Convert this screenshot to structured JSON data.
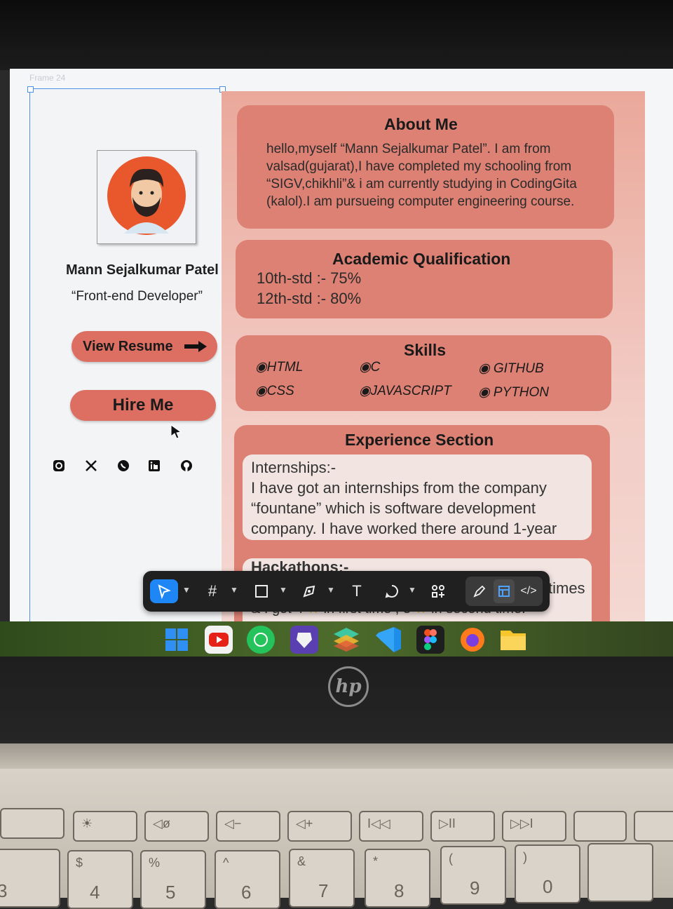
{
  "canvas": {
    "frame_label": "Frame 24"
  },
  "profile": {
    "name": "Mann Sejalkumar Patel",
    "role": "“Front-end Developer”",
    "view_resume_label": "View Resume",
    "hire_me_label": "Hire Me",
    "social_icons": [
      "instagram-icon",
      "x-icon",
      "whatsapp-icon",
      "linkedin-icon",
      "github-icon"
    ]
  },
  "about": {
    "title": "About Me",
    "lines": [
      "hello,myself “Mann Sejalkumar Patel”.  I am from",
      "valsad(gujarat),I have completed my schooling from",
      "“SIGV,chikhli”& i am currently studying in CodingGita",
      "(kalol).I am pursueing computer engineering course."
    ]
  },
  "academic": {
    "title": "Academic Qualification",
    "rows": [
      "10th-std :- 75%",
      "12th-std :- 80%"
    ]
  },
  "skills": {
    "title": "Skills",
    "items": [
      "HTML",
      "C",
      "GITHUB",
      "CSS",
      "JAVASCRIPT",
      "PYTHON"
    ]
  },
  "experience": {
    "title": "Experience Section",
    "internship_heading": "Internships:-",
    "internship_lines": [
      "I have got an internships from the company",
      "“fountane” which is software development",
      "company. I have worked there around 1-year"
    ],
    "hackathon_heading": "Hackathons:-",
    "hackathon_partial_1": "times",
    "hackathon_partial_2": "& I got 4",
    "hackathon_partial_3": "in first time , 3",
    "hackathon_partial_4": "in second time."
  },
  "toolbar": {
    "tools": [
      "move-tool",
      "frame-tool",
      "shape-tool",
      "pen-tool",
      "text-tool",
      "comment-tool",
      "actions-tool"
    ],
    "text_tool_glyph": "T",
    "mode_buttons": [
      "draw-mode",
      "design-mode",
      "dev-mode"
    ]
  },
  "taskbar": {
    "apps": [
      "start",
      "youtube",
      "whatsapp",
      "brave",
      "layers-app",
      "vscode",
      "figma",
      "firefox",
      "file-explorer"
    ]
  },
  "keyboard": {
    "keys": [
      {
        "top": "$",
        "main": "4"
      },
      {
        "top": "%",
        "main": "5"
      },
      {
        "top": "^",
        "main": "6"
      },
      {
        "top": "&",
        "main": "7"
      },
      {
        "top": "*",
        "main": "8"
      },
      {
        "top": "(",
        "main": "9"
      },
      {
        "top": ")",
        "main": "0"
      }
    ],
    "edge_key": "3"
  },
  "colors": {
    "card": "#dd8174",
    "button": "#dd6e62",
    "selection": "#4d8fe6",
    "toolbar": "#202020"
  }
}
